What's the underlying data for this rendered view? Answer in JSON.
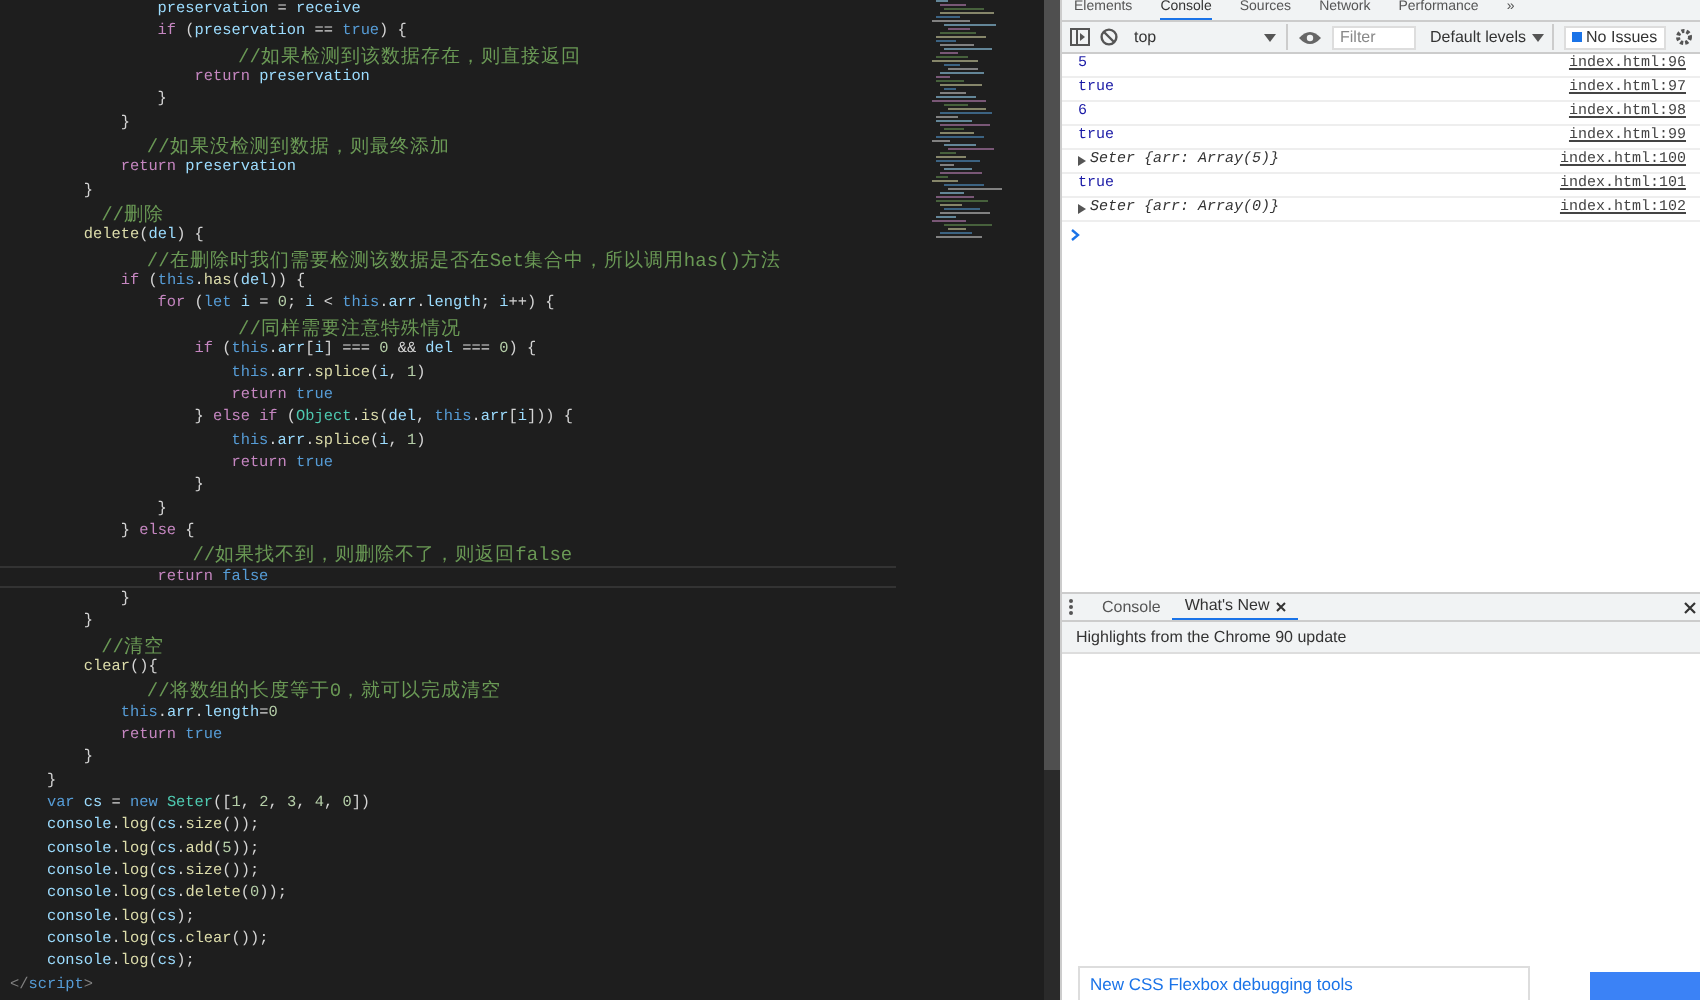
{
  "editor": {
    "lines": [
      {
        "current": false,
        "tokens": [
          {
            "kind": "v",
            "text": "                preservation"
          },
          {
            "kind": "p",
            "text": " = "
          },
          {
            "kind": "v",
            "text": "receive"
          }
        ]
      },
      {
        "current": false,
        "tokens": [
          {
            "kind": "kw",
            "text": "                if"
          },
          {
            "kind": "p",
            "text": " ("
          },
          {
            "kind": "v",
            "text": "preservation"
          },
          {
            "kind": "p",
            "text": " == "
          },
          {
            "kind": "bl",
            "text": "true"
          },
          {
            "kind": "p",
            "text": ") {"
          }
        ]
      },
      {
        "current": false,
        "tokens": [
          {
            "kind": "c",
            "text": "                    //如果检测到该数据存在，则直接返回"
          }
        ]
      },
      {
        "current": false,
        "tokens": [
          {
            "kind": "kw",
            "text": "                    return "
          },
          {
            "kind": "v",
            "text": "preservation"
          }
        ]
      },
      {
        "current": false,
        "tokens": [
          {
            "kind": "p",
            "text": "                }"
          }
        ]
      },
      {
        "current": false,
        "tokens": [
          {
            "kind": "p",
            "text": "            }"
          }
        ]
      },
      {
        "current": false,
        "tokens": [
          {
            "kind": "c",
            "text": "            //如果没检测到数据，则最终添加"
          }
        ]
      },
      {
        "current": false,
        "tokens": [
          {
            "kind": "kw",
            "text": "            return "
          },
          {
            "kind": "v",
            "text": "preservation"
          }
        ]
      },
      {
        "current": false,
        "tokens": [
          {
            "kind": "p",
            "text": "        }"
          }
        ]
      },
      {
        "current": false,
        "tokens": [
          {
            "kind": "c",
            "text": "        //删除"
          }
        ]
      },
      {
        "current": false,
        "tokens": [
          {
            "kind": "fn",
            "text": "        delete"
          },
          {
            "kind": "p",
            "text": "("
          },
          {
            "kind": "v",
            "text": "del"
          },
          {
            "kind": "p",
            "text": ") {"
          }
        ]
      },
      {
        "current": false,
        "tokens": [
          {
            "kind": "c",
            "text": "            //在删除时我们需要检测该数据是否在Set集合中，所以调用has()方法"
          }
        ]
      },
      {
        "current": false,
        "tokens": [
          {
            "kind": "kw",
            "text": "            if"
          },
          {
            "kind": "p",
            "text": " ("
          },
          {
            "kind": "bl",
            "text": "this"
          },
          {
            "kind": "p",
            "text": "."
          },
          {
            "kind": "fn",
            "text": "has"
          },
          {
            "kind": "p",
            "text": "("
          },
          {
            "kind": "v",
            "text": "del"
          },
          {
            "kind": "p",
            "text": ")) {"
          }
        ]
      },
      {
        "current": false,
        "tokens": [
          {
            "kind": "kw",
            "text": "                for"
          },
          {
            "kind": "p",
            "text": " ("
          },
          {
            "kind": "bl",
            "text": "let "
          },
          {
            "kind": "v",
            "text": "i"
          },
          {
            "kind": "p",
            "text": " = "
          },
          {
            "kind": "n",
            "text": "0"
          },
          {
            "kind": "p",
            "text": "; "
          },
          {
            "kind": "v",
            "text": "i"
          },
          {
            "kind": "p",
            "text": " < "
          },
          {
            "kind": "bl",
            "text": "this"
          },
          {
            "kind": "p",
            "text": "."
          },
          {
            "kind": "v",
            "text": "arr"
          },
          {
            "kind": "p",
            "text": "."
          },
          {
            "kind": "v",
            "text": "length"
          },
          {
            "kind": "p",
            "text": "; "
          },
          {
            "kind": "v",
            "text": "i"
          },
          {
            "kind": "p",
            "text": "++) {"
          }
        ]
      },
      {
        "current": false,
        "tokens": [
          {
            "kind": "c",
            "text": "                    //同样需要注意特殊情况"
          }
        ]
      },
      {
        "current": false,
        "tokens": [
          {
            "kind": "kw",
            "text": "                    if"
          },
          {
            "kind": "p",
            "text": " ("
          },
          {
            "kind": "bl",
            "text": "this"
          },
          {
            "kind": "p",
            "text": "."
          },
          {
            "kind": "v",
            "text": "arr"
          },
          {
            "kind": "p",
            "text": "["
          },
          {
            "kind": "v",
            "text": "i"
          },
          {
            "kind": "p",
            "text": "] === "
          },
          {
            "kind": "n",
            "text": "0"
          },
          {
            "kind": "p",
            "text": " && "
          },
          {
            "kind": "v",
            "text": "del"
          },
          {
            "kind": "p",
            "text": " === "
          },
          {
            "kind": "n",
            "text": "0"
          },
          {
            "kind": "p",
            "text": ") {"
          }
        ]
      },
      {
        "current": false,
        "tokens": [
          {
            "kind": "bl",
            "text": "                        this"
          },
          {
            "kind": "p",
            "text": "."
          },
          {
            "kind": "v",
            "text": "arr"
          },
          {
            "kind": "p",
            "text": "."
          },
          {
            "kind": "fn",
            "text": "splice"
          },
          {
            "kind": "p",
            "text": "("
          },
          {
            "kind": "v",
            "text": "i"
          },
          {
            "kind": "p",
            "text": ", "
          },
          {
            "kind": "n",
            "text": "1"
          },
          {
            "kind": "p",
            "text": ")"
          }
        ]
      },
      {
        "current": false,
        "tokens": [
          {
            "kind": "kw",
            "text": "                        return "
          },
          {
            "kind": "bl",
            "text": "true"
          }
        ]
      },
      {
        "current": false,
        "tokens": [
          {
            "kind": "p",
            "text": "                    } "
          },
          {
            "kind": "kw",
            "text": "else if"
          },
          {
            "kind": "p",
            "text": " ("
          },
          {
            "kind": "cls",
            "text": "Object"
          },
          {
            "kind": "p",
            "text": "."
          },
          {
            "kind": "fn",
            "text": "is"
          },
          {
            "kind": "p",
            "text": "("
          },
          {
            "kind": "v",
            "text": "del"
          },
          {
            "kind": "p",
            "text": ", "
          },
          {
            "kind": "bl",
            "text": "this"
          },
          {
            "kind": "p",
            "text": "."
          },
          {
            "kind": "v",
            "text": "arr"
          },
          {
            "kind": "p",
            "text": "["
          },
          {
            "kind": "v",
            "text": "i"
          },
          {
            "kind": "p",
            "text": "])) {"
          }
        ]
      },
      {
        "current": false,
        "tokens": [
          {
            "kind": "bl",
            "text": "                        this"
          },
          {
            "kind": "p",
            "text": "."
          },
          {
            "kind": "v",
            "text": "arr"
          },
          {
            "kind": "p",
            "text": "."
          },
          {
            "kind": "fn",
            "text": "splice"
          },
          {
            "kind": "p",
            "text": "("
          },
          {
            "kind": "v",
            "text": "i"
          },
          {
            "kind": "p",
            "text": ", "
          },
          {
            "kind": "n",
            "text": "1"
          },
          {
            "kind": "p",
            "text": ")"
          }
        ]
      },
      {
        "current": false,
        "tokens": [
          {
            "kind": "kw",
            "text": "                        return "
          },
          {
            "kind": "bl",
            "text": "true"
          }
        ]
      },
      {
        "current": false,
        "tokens": [
          {
            "kind": "p",
            "text": "                    }"
          }
        ]
      },
      {
        "current": false,
        "tokens": [
          {
            "kind": "p",
            "text": "                }"
          }
        ]
      },
      {
        "current": false,
        "tokens": [
          {
            "kind": "p",
            "text": "            } "
          },
          {
            "kind": "kw",
            "text": "else"
          },
          {
            "kind": "p",
            "text": " {"
          }
        ]
      },
      {
        "current": false,
        "tokens": [
          {
            "kind": "c",
            "text": "                //如果找不到，则删除不了，则返回false"
          }
        ]
      },
      {
        "current": true,
        "tokens": [
          {
            "kind": "kw",
            "text": "                return "
          },
          {
            "kind": "bl",
            "text": "false"
          }
        ]
      },
      {
        "current": false,
        "tokens": [
          {
            "kind": "p",
            "text": "            }"
          }
        ]
      },
      {
        "current": false,
        "tokens": [
          {
            "kind": "p",
            "text": "        }"
          }
        ]
      },
      {
        "current": false,
        "tokens": [
          {
            "kind": "c",
            "text": "        //清空"
          }
        ]
      },
      {
        "current": false,
        "tokens": [
          {
            "kind": "fn",
            "text": "        clear"
          },
          {
            "kind": "p",
            "text": "(){"
          }
        ]
      },
      {
        "current": false,
        "tokens": [
          {
            "kind": "c",
            "text": "            //将数组的长度等于0，就可以完成清空"
          }
        ]
      },
      {
        "current": false,
        "tokens": [
          {
            "kind": "bl",
            "text": "            this"
          },
          {
            "kind": "p",
            "text": "."
          },
          {
            "kind": "v",
            "text": "arr"
          },
          {
            "kind": "p",
            "text": "."
          },
          {
            "kind": "v",
            "text": "length"
          },
          {
            "kind": "p",
            "text": "="
          },
          {
            "kind": "n",
            "text": "0"
          }
        ]
      },
      {
        "current": false,
        "tokens": [
          {
            "kind": "kw",
            "text": "            return "
          },
          {
            "kind": "bl",
            "text": "true"
          }
        ]
      },
      {
        "current": false,
        "tokens": [
          {
            "kind": "p",
            "text": "        }"
          }
        ]
      },
      {
        "current": false,
        "tokens": [
          {
            "kind": "p",
            "text": "    }"
          }
        ]
      },
      {
        "current": false,
        "tokens": [
          {
            "kind": "bl",
            "text": "    var "
          },
          {
            "kind": "v",
            "text": "cs"
          },
          {
            "kind": "p",
            "text": " = "
          },
          {
            "kind": "bl",
            "text": "new "
          },
          {
            "kind": "cls",
            "text": "Seter"
          },
          {
            "kind": "p",
            "text": "(["
          },
          {
            "kind": "n",
            "text": "1"
          },
          {
            "kind": "p",
            "text": ", "
          },
          {
            "kind": "n",
            "text": "2"
          },
          {
            "kind": "p",
            "text": ", "
          },
          {
            "kind": "n",
            "text": "3"
          },
          {
            "kind": "p",
            "text": ", "
          },
          {
            "kind": "n",
            "text": "4"
          },
          {
            "kind": "p",
            "text": ", "
          },
          {
            "kind": "n",
            "text": "0"
          },
          {
            "kind": "p",
            "text": "])"
          }
        ]
      },
      {
        "current": false,
        "tokens": [
          {
            "kind": "v",
            "text": "    console"
          },
          {
            "kind": "p",
            "text": "."
          },
          {
            "kind": "fn",
            "text": "log"
          },
          {
            "kind": "p",
            "text": "("
          },
          {
            "kind": "v",
            "text": "cs"
          },
          {
            "kind": "p",
            "text": "."
          },
          {
            "kind": "fn",
            "text": "size"
          },
          {
            "kind": "p",
            "text": "());"
          }
        ]
      },
      {
        "current": false,
        "tokens": [
          {
            "kind": "v",
            "text": "    console"
          },
          {
            "kind": "p",
            "text": "."
          },
          {
            "kind": "fn",
            "text": "log"
          },
          {
            "kind": "p",
            "text": "("
          },
          {
            "kind": "v",
            "text": "cs"
          },
          {
            "kind": "p",
            "text": "."
          },
          {
            "kind": "fn",
            "text": "add"
          },
          {
            "kind": "p",
            "text": "("
          },
          {
            "kind": "n",
            "text": "5"
          },
          {
            "kind": "p",
            "text": "));"
          }
        ]
      },
      {
        "current": false,
        "tokens": [
          {
            "kind": "v",
            "text": "    console"
          },
          {
            "kind": "p",
            "text": "."
          },
          {
            "kind": "fn",
            "text": "log"
          },
          {
            "kind": "p",
            "text": "("
          },
          {
            "kind": "v",
            "text": "cs"
          },
          {
            "kind": "p",
            "text": "."
          },
          {
            "kind": "fn",
            "text": "size"
          },
          {
            "kind": "p",
            "text": "());"
          }
        ]
      },
      {
        "current": false,
        "tokens": [
          {
            "kind": "v",
            "text": "    console"
          },
          {
            "kind": "p",
            "text": "."
          },
          {
            "kind": "fn",
            "text": "log"
          },
          {
            "kind": "p",
            "text": "("
          },
          {
            "kind": "v",
            "text": "cs"
          },
          {
            "kind": "p",
            "text": "."
          },
          {
            "kind": "fn",
            "text": "delete"
          },
          {
            "kind": "p",
            "text": "("
          },
          {
            "kind": "n",
            "text": "0"
          },
          {
            "kind": "p",
            "text": "));"
          }
        ]
      },
      {
        "current": false,
        "tokens": [
          {
            "kind": "v",
            "text": "    console"
          },
          {
            "kind": "p",
            "text": "."
          },
          {
            "kind": "fn",
            "text": "log"
          },
          {
            "kind": "p",
            "text": "("
          },
          {
            "kind": "v",
            "text": "cs"
          },
          {
            "kind": "p",
            "text": ");"
          }
        ]
      },
      {
        "current": false,
        "tokens": [
          {
            "kind": "v",
            "text": "    console"
          },
          {
            "kind": "p",
            "text": "."
          },
          {
            "kind": "fn",
            "text": "log"
          },
          {
            "kind": "p",
            "text": "("
          },
          {
            "kind": "v",
            "text": "cs"
          },
          {
            "kind": "p",
            "text": "."
          },
          {
            "kind": "fn",
            "text": "clear"
          },
          {
            "kind": "p",
            "text": "());"
          }
        ]
      },
      {
        "current": false,
        "tokens": [
          {
            "kind": "v",
            "text": "    console"
          },
          {
            "kind": "p",
            "text": "."
          },
          {
            "kind": "fn",
            "text": "log"
          },
          {
            "kind": "p",
            "text": "("
          },
          {
            "kind": "v",
            "text": "cs"
          },
          {
            "kind": "p",
            "text": ");"
          }
        ]
      },
      {
        "current": false,
        "tokens": [
          {
            "kind": "tag",
            "text": "</"
          },
          {
            "kind": "bl",
            "text": "script"
          },
          {
            "kind": "tag",
            "text": ">"
          }
        ]
      }
    ]
  },
  "devtools": {
    "tabs": [
      {
        "label": "Elements",
        "selected": false
      },
      {
        "label": "Console",
        "selected": true
      },
      {
        "label": "Sources",
        "selected": false
      },
      {
        "label": "Network",
        "selected": false
      },
      {
        "label": "Performance",
        "selected": false
      },
      {
        "label": "»",
        "selected": false
      }
    ],
    "toolbar": {
      "context": "top",
      "filter": {
        "placeholder": "Filter"
      },
      "levels": "Default levels",
      "issues": "No Issues"
    },
    "messages": [
      {
        "kind": "value",
        "text": "5",
        "source": "index.html:96"
      },
      {
        "kind": "value",
        "text": "true",
        "source": "index.html:97"
      },
      {
        "kind": "value",
        "text": "6",
        "source": "index.html:98"
      },
      {
        "kind": "value",
        "text": "true",
        "source": "index.html:99"
      },
      {
        "kind": "object",
        "text": "Seter {arr: Array(5)}",
        "source": "index.html:100"
      },
      {
        "kind": "value",
        "text": "true",
        "source": "index.html:101"
      },
      {
        "kind": "object",
        "text": "Seter {arr: Array(0)}",
        "source": "index.html:102"
      }
    ],
    "drawer": {
      "tabs": [
        {
          "label": "Console",
          "selected": false,
          "closable": false
        },
        {
          "label": "What's New",
          "selected": true,
          "closable": true
        }
      ],
      "heading": "Highlights from the Chrome 90 update",
      "link": "New CSS Flexbox debugging tools"
    }
  }
}
